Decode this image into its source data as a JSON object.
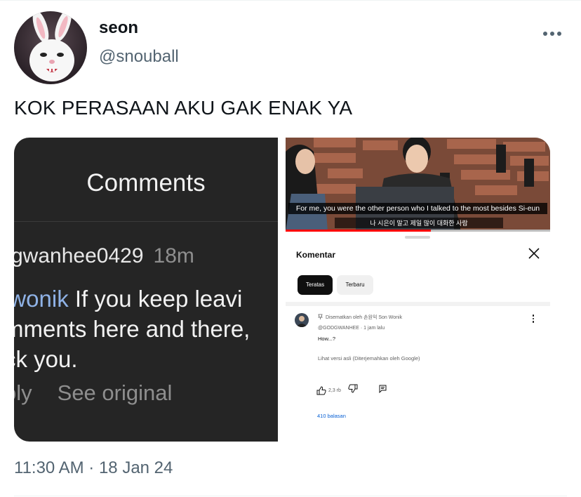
{
  "tweet": {
    "display_name": "seon",
    "handle": "@snouball",
    "text": "KOK PERASAAN AKU GAK ENAK YA",
    "timestamp": "11:30 AM · 18 Jan 24",
    "more_icon": "more-horizontal-icon"
  },
  "left_screenshot": {
    "title": "Comments",
    "username": "gwanhee0429",
    "time": "18m",
    "mention": "iwonik",
    "comment_line1_rest": " If you keep leavi",
    "comment_line2": "mments here and there,",
    "comment_line3": "ck you.",
    "reply_label": "oly",
    "see_original_label": "See original"
  },
  "right_screenshot": {
    "video_caption": "For me, you were the other person who I talked to the most besides Si-eun",
    "video_korean_sub": "나 시은이 말고 제일 많이 대화한 사람",
    "video_progress": 0.55,
    "sheet_title": "Komentar",
    "chip_top": "Teratas",
    "chip_newest": "Terbaru",
    "pinned_by": "Disematkan oleh 손원익 Son Wonik",
    "comment_author": "@GODGWANHEE · 1 jam lalu",
    "comment_text": "How...?",
    "translate_text": "Lihat versi asli (Diterjemahkan oleh Google)",
    "like_count": "2,3 rb",
    "replies": "410 balasan",
    "colors": {
      "replies_link": "#065fd4",
      "progress": "#ff0000"
    }
  }
}
